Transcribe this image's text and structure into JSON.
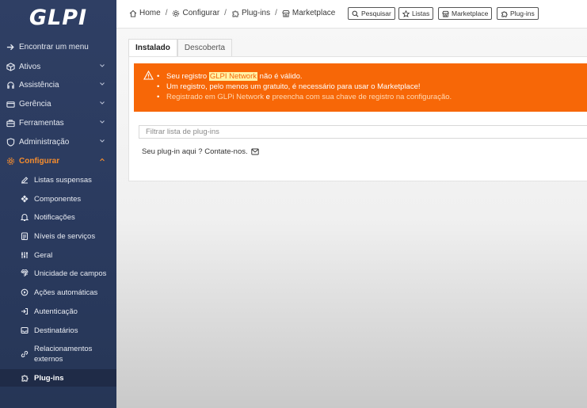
{
  "app": {
    "logo_text": "GLPI"
  },
  "sidebar": {
    "items": [
      {
        "label": "Encontrar um menu",
        "icon": "arrow-right-icon"
      },
      {
        "label": "Ativos",
        "icon": "box-icon"
      },
      {
        "label": "Assistência",
        "icon": "headset-icon"
      },
      {
        "label": "Gerência",
        "icon": "wallet-icon"
      },
      {
        "label": "Ferramentas",
        "icon": "briefcase-icon"
      },
      {
        "label": "Administração",
        "icon": "shield-icon"
      },
      {
        "label": "Configurar",
        "icon": "gear-icon"
      }
    ],
    "submenu": [
      {
        "label": "Listas suspensas",
        "icon": "edit-icon"
      },
      {
        "label": "Componentes",
        "icon": "components-icon"
      },
      {
        "label": "Notificações",
        "icon": "bell-icon"
      },
      {
        "label": "Níveis de serviços",
        "icon": "checklist-icon"
      },
      {
        "label": "Geral",
        "icon": "sliders-icon"
      },
      {
        "label": "Unicidade de campos",
        "icon": "fingerprint-icon"
      },
      {
        "label": "Ações automáticas",
        "icon": "automation-icon"
      },
      {
        "label": "Autenticação",
        "icon": "login-icon"
      },
      {
        "label": "Destinatários",
        "icon": "inbox-icon"
      },
      {
        "label_line1": "Relacionamentos",
        "label_line2": "externos",
        "icon": "link-icon"
      },
      {
        "label": "Plug-ins",
        "icon": "puzzle-icon"
      }
    ]
  },
  "breadcrumb": {
    "home": "Home",
    "configurar": "Configurar",
    "plugins": "Plug-ins",
    "marketplace": "Marketplace"
  },
  "toolbar": {
    "search": "Pesquisar",
    "lists": "Listas",
    "marketplace": "Marketplace",
    "plugins": "Plug-ins"
  },
  "tabs": {
    "installed": "Instalado",
    "discover": "Descoberta"
  },
  "alert": {
    "line1_pre": "Seu registro ",
    "line1_highlight": "GLPI Network",
    "line1_post": " não é válido.",
    "line2": "Um registro, pelo menos um gratuito, é necessário para usar o Marketplace!",
    "line3_link1": "Registrado em GLPi Network",
    "line3_mid": " e ",
    "line3_link2": "preencha com sua chave de registro na configuração."
  },
  "filter": {
    "placeholder": "Filtrar lista de plug-ins"
  },
  "contact": {
    "text": "Seu plug-in aqui ? Contate-nos."
  },
  "colors": {
    "sidebar_bg": "#2f3f64",
    "accent": "#f68d2e",
    "alert_bg": "#f76707"
  }
}
